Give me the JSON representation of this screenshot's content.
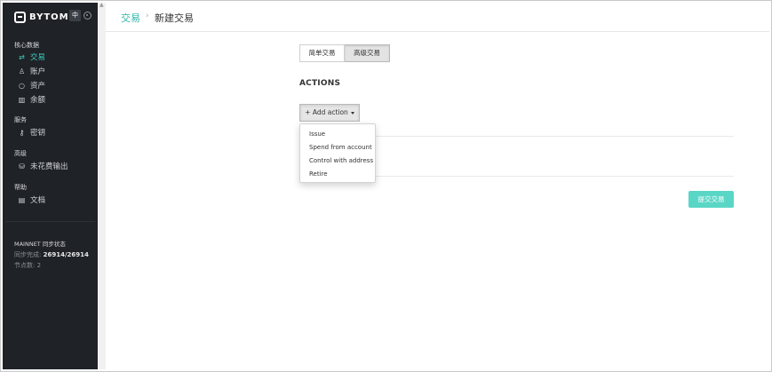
{
  "sidebar": {
    "brand": "BYTOM",
    "lang_button": "中",
    "sections": [
      {
        "title": "核心数据",
        "items": [
          {
            "label": "交易",
            "icon": "exchange-icon",
            "glyph": "⇄",
            "active": true
          },
          {
            "label": "账户",
            "icon": "user-icon",
            "glyph": "♙",
            "active": false
          },
          {
            "label": "资产",
            "icon": "circle-icon",
            "glyph": "○",
            "active": false
          },
          {
            "label": "余额",
            "icon": "bar-chart-icon",
            "glyph": "▥",
            "active": false
          }
        ]
      },
      {
        "title": "服务",
        "items": [
          {
            "label": "密钥",
            "icon": "key-icon",
            "glyph": "⚷",
            "active": false
          }
        ]
      },
      {
        "title": "高级",
        "items": [
          {
            "label": "未花费输出",
            "icon": "database-icon",
            "glyph": "⛁",
            "active": false
          }
        ]
      },
      {
        "title": "帮助",
        "items": [
          {
            "label": "文档",
            "icon": "document-icon",
            "glyph": "▤",
            "active": false
          }
        ]
      }
    ],
    "status": {
      "title": "MAINNET 同步状态",
      "sync_label": "同步完成:",
      "sync_value": "26914/26914",
      "peers_label": "节点数:",
      "peers_value": "2"
    }
  },
  "header": {
    "breadcrumb_link": "交易",
    "breadcrumb_sep": "›",
    "breadcrumb_current": "新建交易"
  },
  "main": {
    "tabs": [
      {
        "label": "简单交易",
        "selected": false
      },
      {
        "label": "高级交易",
        "selected": true
      }
    ],
    "actions_title": "ACTIONS",
    "add_action_label": "+ Add action",
    "dropdown": [
      "Issue",
      "Spend from account",
      "Control with address",
      "Retire"
    ],
    "submit_label": "提交交易"
  },
  "colors": {
    "sidebar_bg": "#1f2227",
    "accent": "#3ecbbd",
    "submit_bg": "#5ad6c6"
  }
}
